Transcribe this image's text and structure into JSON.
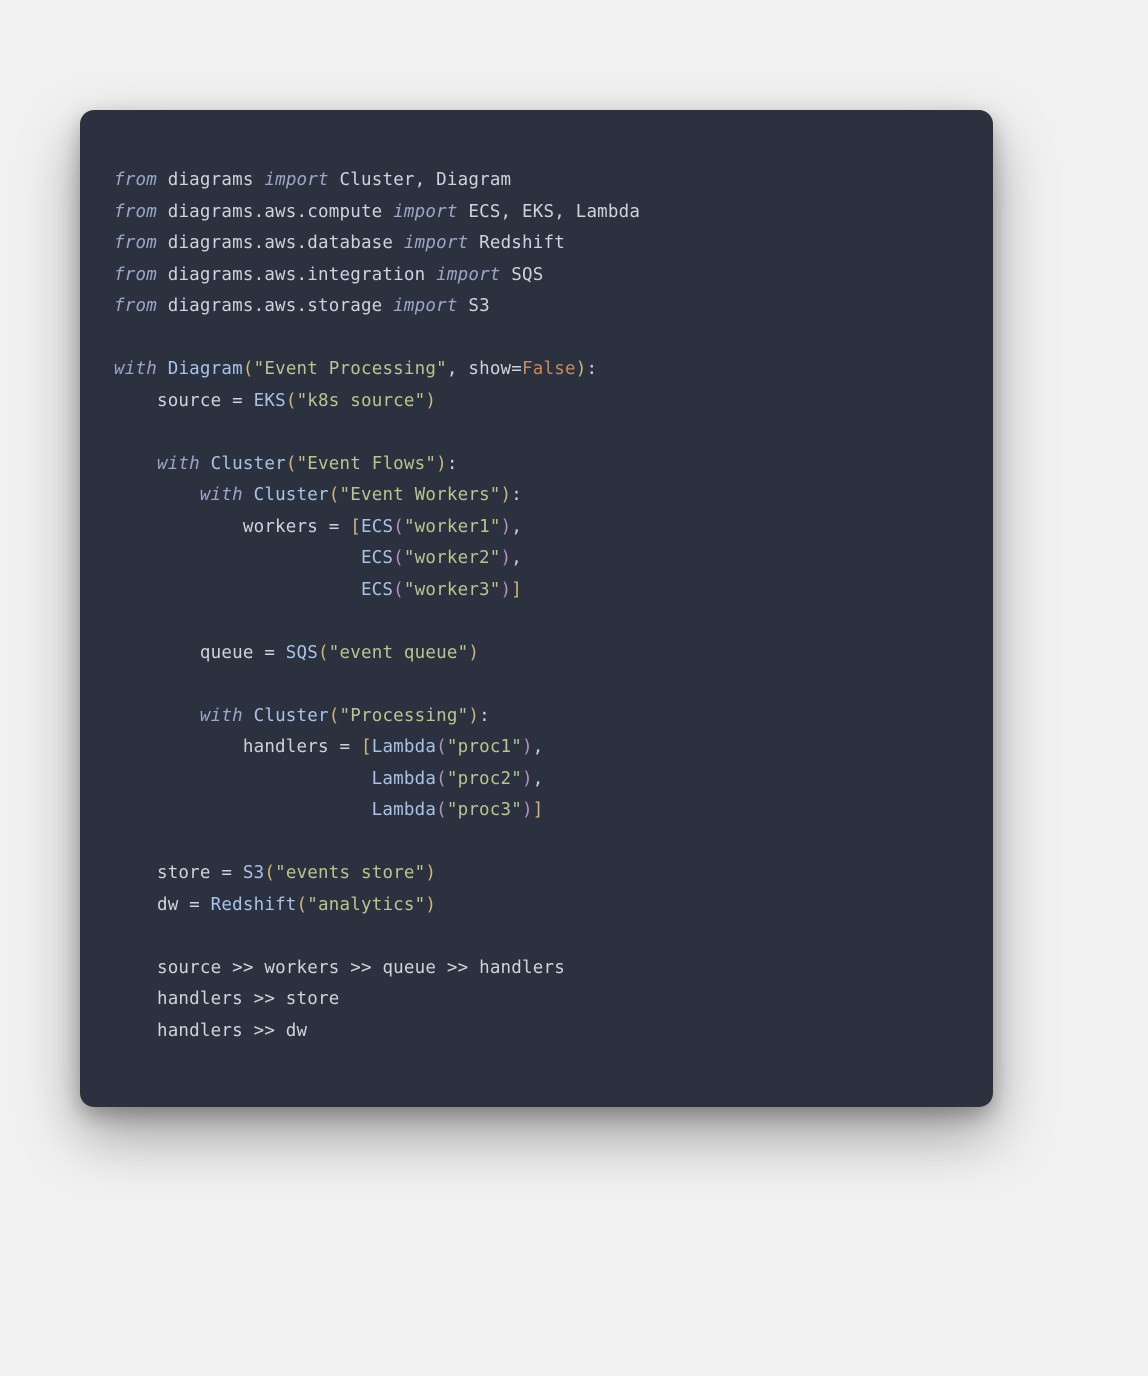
{
  "imports": [
    {
      "module": "diagrams",
      "names": "Cluster, Diagram"
    },
    {
      "module": "diagrams.aws.compute",
      "names": "ECS, EKS, Lambda"
    },
    {
      "module": "diagrams.aws.database",
      "names": "Redshift"
    },
    {
      "module": "diagrams.aws.integration",
      "names": "SQS"
    },
    {
      "module": "diagrams.aws.storage",
      "names": "S3"
    }
  ],
  "kw": {
    "from": "from",
    "import": "import",
    "with": "with"
  },
  "diagram": {
    "class": "Diagram",
    "title": "\"Event Processing\"",
    "show_kw": "show",
    "show_val": "False"
  },
  "vars": {
    "source": "source",
    "workers": "workers",
    "queue": "queue",
    "handlers": "handlers",
    "store": "store",
    "dw": "dw"
  },
  "calls": {
    "EKS": "EKS",
    "Cluster": "Cluster",
    "ECS": "ECS",
    "SQS": "SQS",
    "Lambda": "Lambda",
    "S3": "S3",
    "Redshift": "Redshift"
  },
  "strings": {
    "k8s_source": "\"k8s source\"",
    "event_flows": "\"Event Flows\"",
    "event_workers": "\"Event Workers\"",
    "worker1": "\"worker1\"",
    "worker2": "\"worker2\"",
    "worker3": "\"worker3\"",
    "event_queue": "\"event queue\"",
    "processing": "\"Processing\"",
    "proc1": "\"proc1\"",
    "proc2": "\"proc2\"",
    "proc3": "\"proc3\"",
    "events_store": "\"events store\"",
    "analytics": "\"analytics\""
  },
  "flow": {
    "line1": {
      "a": "source",
      "b": "workers",
      "c": "queue",
      "d": "handlers"
    },
    "line2": {
      "a": "handlers",
      "b": "store"
    },
    "line3": {
      "a": "handlers",
      "b": "dw"
    }
  },
  "ops": {
    "eq": " = ",
    "comma_sp": ", ",
    "colon": ":",
    "shift": " >> ",
    "eq2": "="
  }
}
